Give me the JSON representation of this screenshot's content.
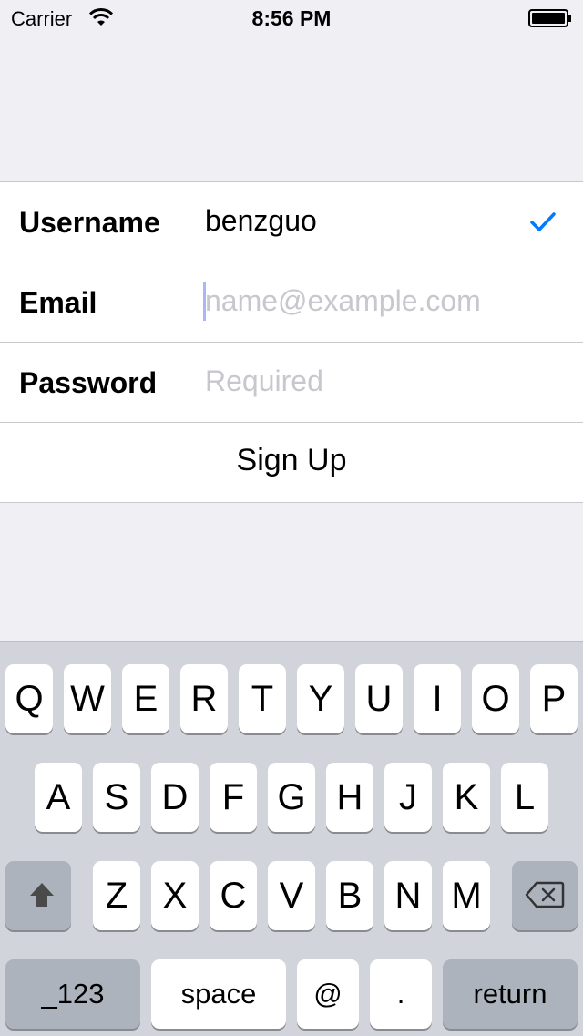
{
  "status_bar": {
    "carrier": "Carrier",
    "time": "8:56 PM"
  },
  "form": {
    "username": {
      "label": "Username",
      "value": "benzguo",
      "valid": true
    },
    "email": {
      "label": "Email",
      "placeholder": "name@example.com"
    },
    "password": {
      "label": "Password",
      "placeholder": "Required"
    },
    "signup_label": "Sign Up"
  },
  "keyboard": {
    "row1": [
      "Q",
      "W",
      "E",
      "R",
      "T",
      "Y",
      "U",
      "I",
      "O",
      "P"
    ],
    "row2": [
      "A",
      "S",
      "D",
      "F",
      "G",
      "H",
      "J",
      "K",
      "L"
    ],
    "row3": [
      "Z",
      "X",
      "C",
      "V",
      "B",
      "N",
      "M"
    ],
    "numbers_label": "_123",
    "space_label": "space",
    "at_label": "@",
    "dot_label": ".",
    "return_label": "return"
  },
  "colors": {
    "tint": "#007aff",
    "background": "#efeff4",
    "placeholder": "#c7c7cd",
    "keyboard_bg": "#d1d5db"
  }
}
